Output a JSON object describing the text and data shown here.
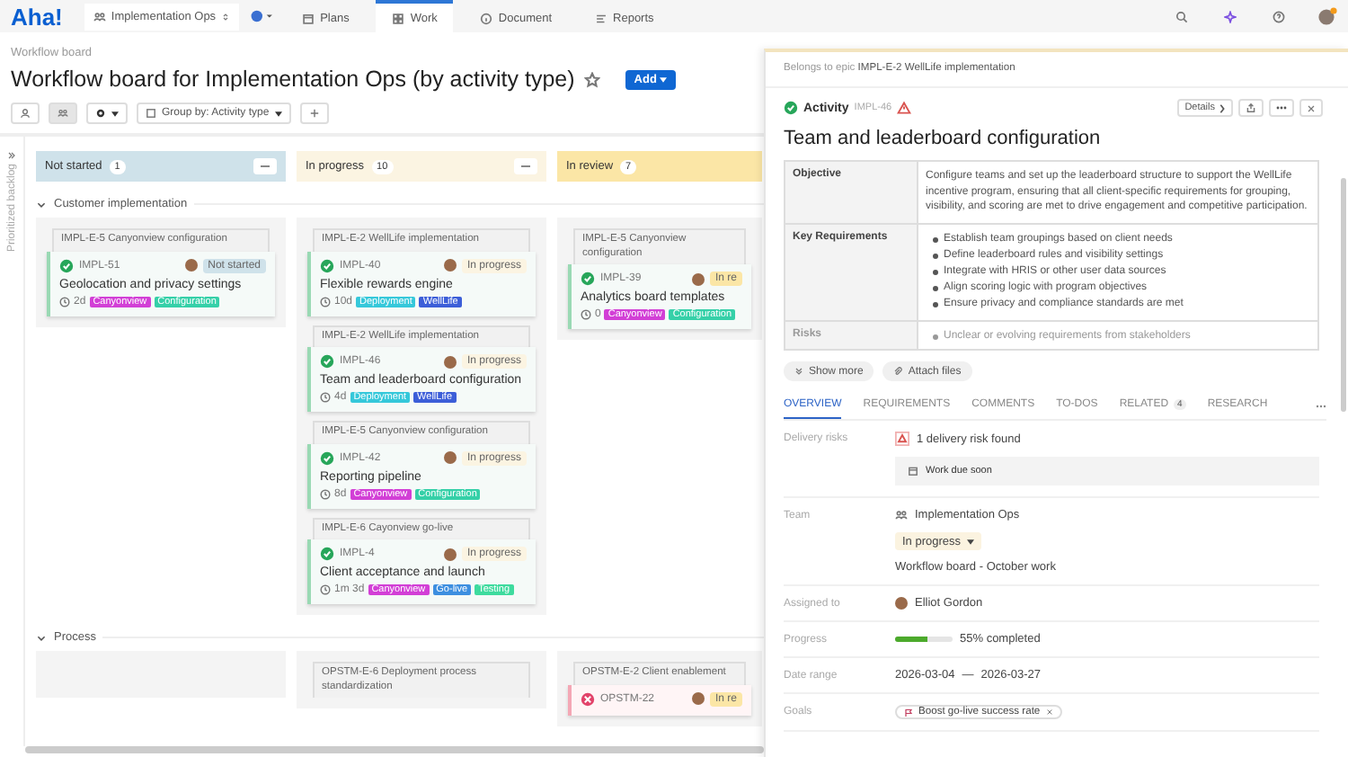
{
  "nav": {
    "logo": "Aha!",
    "workspace": "Implementation Ops",
    "tabs": [
      {
        "label": "Plans",
        "kind": "plans",
        "selected": false
      },
      {
        "label": "Work",
        "kind": "work",
        "selected": true
      },
      {
        "label": "Document",
        "kind": "document",
        "selected": false
      },
      {
        "label": "Reports",
        "kind": "reports",
        "selected": false
      }
    ]
  },
  "page": {
    "breadcrumb": "Workflow board",
    "title": "Workflow board for Implementation Ops (by activity type)",
    "add_button": "Add",
    "group_by": "Group by: Activity type",
    "backlog": "Prioritized backlog"
  },
  "columns": [
    {
      "name": "Not started",
      "count": "1",
      "color": "#cfe2ea"
    },
    {
      "name": "In progress",
      "count": "10",
      "color": "#fbf4e2"
    },
    {
      "name": "In review",
      "count": "7",
      "color": "#fbe6a6"
    }
  ],
  "groups": [
    {
      "name": "Customer implementation",
      "expanded": true,
      "lanes": [
        {
          "kind": "cards",
          "cards": [
            {
              "epic": "IMPL-E-5 Canyonview configuration",
              "id": "IMPL-51",
              "kind": "activity",
              "status": "Not started",
              "title": "Geolocation and privacy settings",
              "estimate": "2d",
              "tags": [
                {
                  "label": "Canyonview",
                  "color": "#d23fd6"
                },
                {
                  "label": "Configuration",
                  "color": "#35d0a8"
                }
              ]
            }
          ]
        },
        {
          "kind": "cards",
          "cards": [
            {
              "epic": "IMPL-E-2 WellLife implementation",
              "id": "IMPL-40",
              "kind": "activity",
              "status": "In progress",
              "title": "Flexible rewards engine",
              "estimate": "10d",
              "tags": [
                {
                  "label": "Deployment",
                  "color": "#35c8da"
                },
                {
                  "label": "WellLife",
                  "color": "#3c5ed8"
                }
              ]
            },
            {
              "epic": "IMPL-E-2 WellLife implementation",
              "id": "IMPL-46",
              "kind": "activity",
              "status": "In progress",
              "title": "Team and leaderboard configuration",
              "estimate": "4d",
              "tags": [
                {
                  "label": "Deployment",
                  "color": "#35c8da"
                },
                {
                  "label": "WellLife",
                  "color": "#3c5ed8"
                }
              ]
            },
            {
              "epic": "IMPL-E-5 Canyonview configuration",
              "id": "IMPL-42",
              "kind": "activity",
              "status": "In progress",
              "title": "Reporting pipeline",
              "estimate": "8d",
              "tags": [
                {
                  "label": "Canyonview",
                  "color": "#d23fd6"
                },
                {
                  "label": "Configuration",
                  "color": "#35d0a8"
                }
              ]
            },
            {
              "epic": "IMPL-E-6 Cayonview go-live",
              "id": "IMPL-4",
              "kind": "activity",
              "status": "In progress",
              "title": "Client acceptance and launch",
              "estimate": "1m 3d",
              "tags": [
                {
                  "label": "Canyonview",
                  "color": "#d23fd6"
                },
                {
                  "label": "Go-live",
                  "color": "#3d8fe0"
                },
                {
                  "label": "Testing",
                  "color": "#3edb9e"
                }
              ]
            }
          ]
        },
        {
          "kind": "cards",
          "cards": [
            {
              "epic": "IMPL-E-5 Canyonview configuration",
              "id": "IMPL-39",
              "kind": "activity",
              "status": "In re",
              "title": "Analytics board templates",
              "estimate": "0",
              "tags": [
                {
                  "label": "Canyonview",
                  "color": "#d23fd6"
                },
                {
                  "label": "Configuration",
                  "color": "#35d0a8"
                }
              ]
            }
          ]
        }
      ]
    },
    {
      "name": "Process",
      "expanded": true,
      "lanes": [
        {
          "kind": "empty"
        },
        {
          "kind": "cards",
          "cards": [
            {
              "epic": "OPSTM-E-6 Deployment process standardization",
              "kind": "epic_only"
            }
          ]
        },
        {
          "kind": "cards",
          "cards": [
            {
              "epic": "OPSTM-E-2 Client enablement",
              "id": "OPSTM-22",
              "kind": "blocked",
              "status": "In re"
            }
          ]
        }
      ]
    }
  ],
  "drawer": {
    "epic_prefix": "Belongs to epic",
    "epic": "IMPL-E-2 WellLife implementation",
    "type": "Activity",
    "id": "IMPL-46",
    "details": "Details",
    "title": "Team and leaderboard configuration",
    "table": [
      {
        "label": "Objective",
        "text": "Configure teams and set up the leaderboard structure to support the WellLife incentive program, ensuring that all client-specific requirements for grouping, visibility, and scoring are met to drive engagement and competitive participation."
      },
      {
        "label": "Key Requirements",
        "bullets": [
          "Establish team groupings based on client needs",
          "Define leaderboard rules and visibility settings",
          "Integrate with HRIS or other user data sources",
          "Align scoring logic with program objectives",
          "Ensure privacy and compliance standards are met"
        ]
      },
      {
        "label": "Risks",
        "faded": true,
        "bullets": [
          "Unclear or evolving requirements from stakeholders"
        ]
      }
    ],
    "buttons": [
      "Show more",
      "Attach files"
    ],
    "tabs": [
      {
        "label": "OVERVIEW",
        "selected": true
      },
      {
        "label": "REQUIREMENTS",
        "selected": false
      },
      {
        "label": "COMMENTS",
        "selected": false
      },
      {
        "label": "TO-DOS",
        "selected": false
      },
      {
        "label": "RELATED",
        "count": "4",
        "selected": false
      },
      {
        "label": "RESEARCH",
        "selected": false
      }
    ],
    "delivery_risks": {
      "label": "Delivery risks",
      "summary": "1 delivery risk found",
      "item": "Work due soon"
    },
    "team": {
      "label": "Team",
      "name": "Implementation Ops",
      "status": "In progress",
      "board": "Workflow board - October work"
    },
    "assigned": {
      "label": "Assigned to",
      "name": "Elliot Gordon"
    },
    "progress": {
      "label": "Progress",
      "level": 0.55,
      "reading": "55% completed"
    },
    "dates": {
      "label": "Date range",
      "start": "2026-03-04",
      "sep": "—",
      "end": "2026-03-27"
    },
    "goals": {
      "label": "Goals",
      "items": [
        "Boost go-live success rate"
      ]
    }
  }
}
